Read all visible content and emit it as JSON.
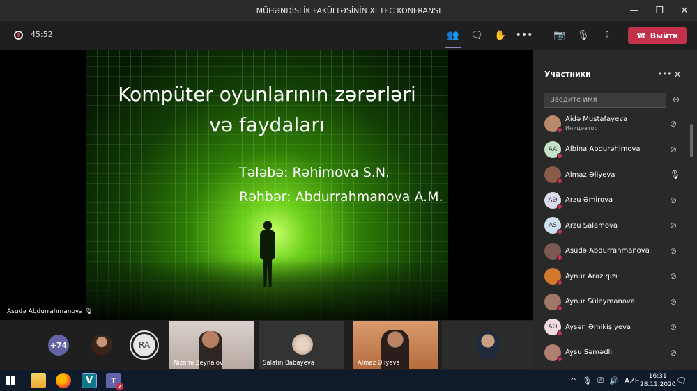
{
  "window": {
    "title": "MÜHƏNDİSLİK FAKÜLTƏSİNİN XI TEC KONFRANSI",
    "controls": [
      "minimize-icon",
      "maximize-icon",
      "close-icon"
    ]
  },
  "toolbar": {
    "timer": "45:52",
    "icons": [
      "participants-icon",
      "chat-icon",
      "raise-hand-icon",
      "more-icon",
      "camera-off-icon",
      "mic-off-icon",
      "share-screen-icon"
    ],
    "leave_label": "Выйти",
    "leave_color": "#c4314b"
  },
  "slide": {
    "title_line1": "Kompüter oyunlarının zərərləri",
    "title_line2": "və faydaları",
    "student": "Tələbə: Rəhimova S.N.",
    "supervisor": "Rəhbər: Abdurrahmanova A.M."
  },
  "stage": {
    "speaker_name": "Asudə Abdurrahmanova"
  },
  "strip": {
    "more_count": "+74",
    "ra_initials": "RA",
    "tiles": [
      {
        "name": "Nizami Zeynalov"
      },
      {
        "name": "Salatın Babayeva"
      },
      {
        "name": "Almaz Əliyeva"
      },
      {
        "name": ""
      }
    ]
  },
  "panel": {
    "title": "Участники",
    "search_placeholder": "Введите имя",
    "participants": [
      {
        "name": "Aidə Mustafayeva",
        "sub": "Инициатор",
        "initials": "",
        "bg": "#b98a6a",
        "mic": "muted"
      },
      {
        "name": "Albina Abdurəhimova",
        "sub": "",
        "initials": "AA",
        "bg": "#c7e3c7",
        "mic": "muted"
      },
      {
        "name": "Almaz Əliyeva",
        "sub": "",
        "initials": "",
        "bg": "#8a5a4a",
        "mic": "on"
      },
      {
        "name": "Arzu Əmirova",
        "sub": "",
        "initials": "AƏ",
        "bg": "#dcdcf0",
        "mic": "muted"
      },
      {
        "name": "Arzu Salamova",
        "sub": "",
        "initials": "AS",
        "bg": "#cfe1f0",
        "mic": "muted"
      },
      {
        "name": "Asudə Abdurrahmanova",
        "sub": "",
        "initials": "",
        "bg": "#7a5a52",
        "mic": "muted"
      },
      {
        "name": "Aynur Araz qızı",
        "sub": "",
        "initials": "",
        "bg": "#d0782c",
        "mic": "muted"
      },
      {
        "name": "Aynur Süleymanova",
        "sub": "",
        "initials": "",
        "bg": "#a07868",
        "mic": "muted"
      },
      {
        "name": "Ayşən Əmikişiyeva",
        "sub": "",
        "initials": "AƏ",
        "bg": "#f2d9e0",
        "mic": "muted"
      },
      {
        "name": "Aysu Səmədli",
        "sub": "",
        "initials": "",
        "bg": "#b08070",
        "mic": "muted"
      }
    ]
  },
  "taskbar": {
    "apps": [
      "file-explorer-icon",
      "firefox-icon",
      "visual-app-icon",
      "teams-icon"
    ],
    "visual_app_letter": "V",
    "teams_letter": "T",
    "teams_badge": "7",
    "language": "AZE",
    "time": "16:31",
    "date": "28.11.2020"
  }
}
